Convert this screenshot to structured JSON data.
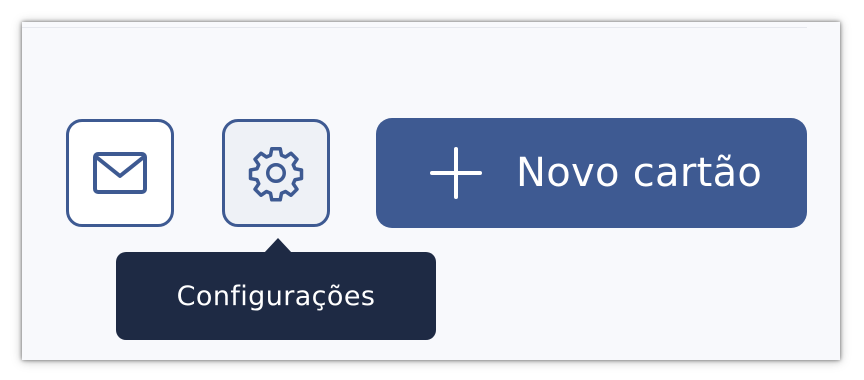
{
  "toolbar": {
    "mail_button": {
      "icon": "mail-icon"
    },
    "settings_button": {
      "icon": "gear-icon"
    },
    "new_card_button": {
      "icon": "plus-icon",
      "label": "Novo cartão"
    }
  },
  "tooltip": {
    "text": "Configurações"
  },
  "colors": {
    "accent": "#3e5a92",
    "tooltip_bg": "#1e2a44",
    "panel_bg": "#f8f9fc"
  }
}
